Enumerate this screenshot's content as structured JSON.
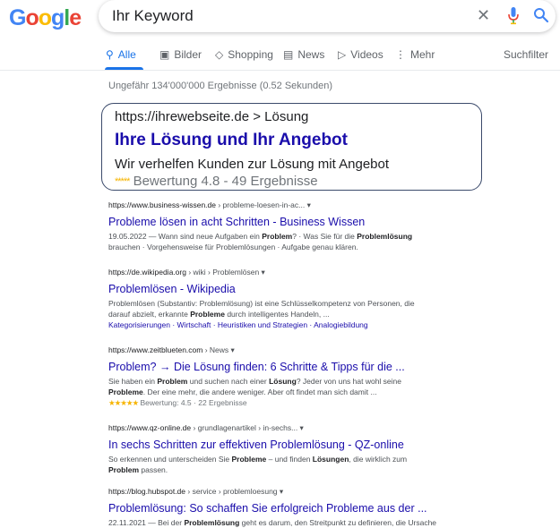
{
  "logo": {
    "letters": [
      "G",
      "o",
      "o",
      "g",
      "l",
      "e"
    ],
    "colors": [
      "#4285f4",
      "#ea4335",
      "#fbbc05",
      "#4285f4",
      "#34a853",
      "#ea4335"
    ]
  },
  "search": {
    "query": "Ihr Keyword",
    "clear_icon": "close-icon",
    "mic_icon": "mic-icon",
    "search_icon": "search-icon"
  },
  "tabs": {
    "items": [
      {
        "label": "Alle",
        "icon": "search-icon",
        "glyph": "⚲"
      },
      {
        "label": "Bilder",
        "icon": "image-icon",
        "glyph": "▣"
      },
      {
        "label": "Shopping",
        "icon": "tag-icon",
        "glyph": "◇"
      },
      {
        "label": "News",
        "icon": "newspaper-icon",
        "glyph": "▤"
      },
      {
        "label": "Videos",
        "icon": "play-icon",
        "glyph": "▷"
      },
      {
        "label": "Mehr",
        "icon": "more-vert-icon",
        "glyph": "⋮"
      }
    ],
    "tools_label": "Suchfilter",
    "accent": "#1a73e8"
  },
  "stats": "Ungefähr 134'000'000 Ergebnisse (0.52 Sekunden)",
  "featured": {
    "url": "https://ihrewebseite.de > Lösung",
    "title": "Ihre Lösung und Ihr Angebot",
    "description": "Wir verhelfen Kunden zur Lösung mit Angebot",
    "stars": "*****",
    "rating": "Bewertung 4.8  -  49 Ergebnisse"
  },
  "results": [
    {
      "domain": "https://www.business-wissen.de",
      "path": " › probleme-loesen-in-ac...  ▾",
      "title": "Probleme lösen in acht Schritten - Business Wissen",
      "snippet_line1": "19.05.2022 — Wann sind neue Aufgaben ein Problem? · Was Sie für die Problemlösung",
      "snippet_line2": "brauchen · Vorgehensweise für Problemlösungen · Aufgabe genau klären."
    },
    {
      "domain": "https://de.wikipedia.org",
      "path": " › wiki › Problemlösen  ▾",
      "title": "Problemlösen - Wikipedia",
      "snippet_line1": "Problemlösen (Substantiv: Problemlösung) ist eine Schlüsselkompetenz von Personen, die",
      "snippet_line2": "darauf abzielt, erkannte Probleme durch intelligentes Handeln, ...",
      "links": "Kategorisierungen · Wirtschaft · Heuristiken und Strategien · Analogiebildung"
    },
    {
      "domain": "https://www.zeitblueten.com",
      "path": " › News  ▾",
      "title": "Problem? → Die Lösung finden: 6 Schritte & Tipps für die ...",
      "snippet_line1": "Sie haben ein Problem und suchen nach einer Lösung? Jeder von uns hat wohl seine",
      "snippet_line2": "Probleme. Der eine mehr, die andere weniger. Aber oft findet man sich damit ...",
      "stars": "★★★★★",
      "rating": "Bewertung: 4.5 · 22 Ergebnisse"
    },
    {
      "domain": "https://www.qz-online.de",
      "path": " › grundlagenartikel › in-sechs...  ▾",
      "title": "In sechs Schritten zur effektiven Problemlösung - QZ-online",
      "snippet_line1": "So erkennen und unterscheiden Sie Probleme – und finden Lösungen, die wirklich zum",
      "snippet_line2": "Problem passen."
    },
    {
      "domain": "https://blog.hubspot.de",
      "path": " › service › problemloesung  ▾",
      "title": "Problemlösung: So schaffen Sie erfolgreich Probleme aus der ...",
      "snippet_line1": "22.11.2021 — Bei der Problemlösung geht es darum, den Streitpunkt zu definieren, die Ursache"
    }
  ]
}
